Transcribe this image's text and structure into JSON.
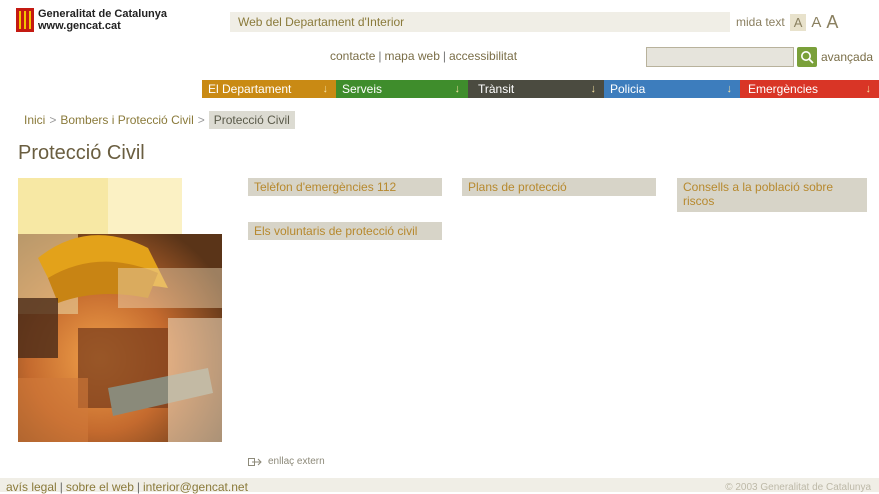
{
  "header": {
    "org_line1": "Generalitat de Catalunya",
    "org_line2": "www.gencat.cat",
    "department": "Web del Departament d'Interior",
    "text_size_label": "mida text",
    "text_size_options": [
      "A",
      "A",
      "A"
    ]
  },
  "utility_links": [
    "contacte",
    "mapa web",
    "accessibilitat"
  ],
  "search": {
    "placeholder": "",
    "advanced_label": "avançada"
  },
  "nav": [
    {
      "label": "El Departament",
      "color": "#c98a14"
    },
    {
      "label": "Serveis",
      "color": "#3f8d2c"
    },
    {
      "label": "Trànsit",
      "color": "#4b4b40"
    },
    {
      "label": "Policia",
      "color": "#3d7dbd"
    },
    {
      "label": "Emergències",
      "color": "#d93526"
    }
  ],
  "nav_arrow": "↓",
  "breadcrumb": {
    "items": [
      "Inici",
      "Bombers i Protecció Civil"
    ],
    "separator": ">",
    "current": "Protecció Civil"
  },
  "page_title": "Protecció Civil",
  "tiles": [
    "Telèfon d'emergències 112",
    "Plans de protecció",
    "Consells a la població sobre riscos",
    "Els voluntaris de protecció civil"
  ],
  "external_link_label": "enllaç extern",
  "footer": {
    "links": [
      "avís legal",
      "sobre el web",
      "interior@gencat.net"
    ],
    "copyright": "© 2003 Generalitat de Catalunya"
  }
}
